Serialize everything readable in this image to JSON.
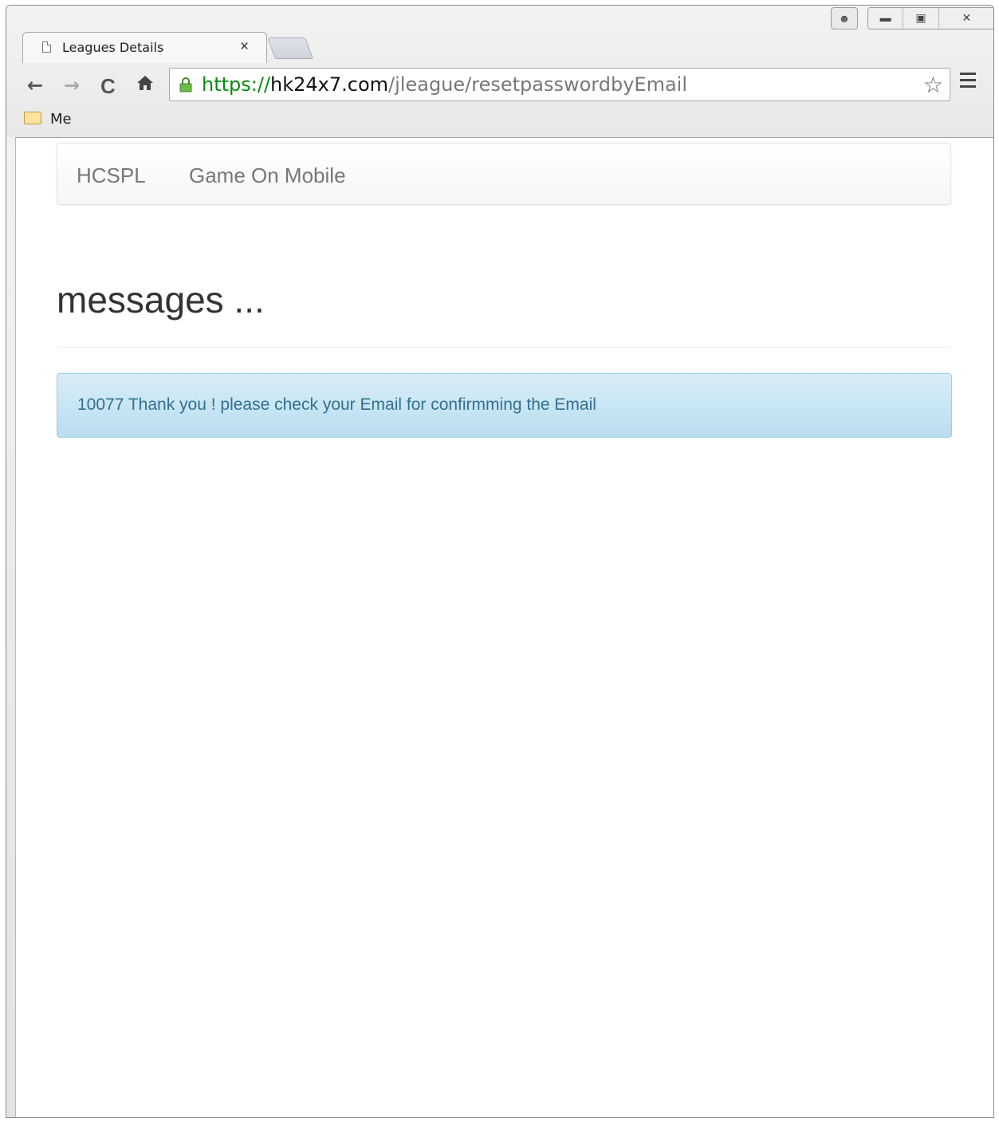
{
  "browser": {
    "tab_title": "Leagues Details",
    "tab_close": "×",
    "url_scheme": "https://",
    "url_host": "hk24x7.com",
    "url_path": "/jleague/resetpasswordbyEmail",
    "bookmark_label": "Me",
    "nav": {
      "back": "←",
      "forward": "→",
      "reload": "C",
      "home": "🏠"
    }
  },
  "page": {
    "navbar": {
      "brand": "HCSPL",
      "link": "Game On Mobile"
    },
    "heading": "messages ...",
    "alert_message": "10077 Thank you ! please check your Email for confirmming the Email"
  },
  "colors": {
    "alert_text": "#31708f",
    "alert_bg": "#d9edf7",
    "url_scheme": "#0a8a12"
  }
}
